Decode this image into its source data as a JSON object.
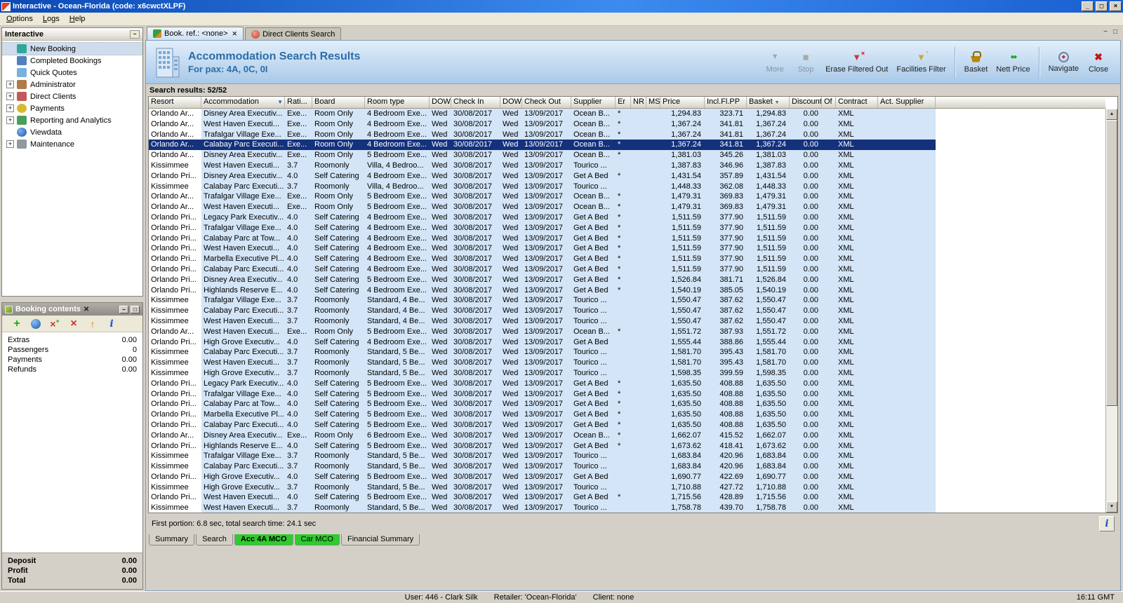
{
  "window": {
    "title": "Interactive - Ocean-Florida (code: x6cwctXLPF)",
    "menu": [
      "Options",
      "Logs",
      "Help"
    ]
  },
  "colors": {
    "selection": "#14317c",
    "row_highlight": "#d3e5f7",
    "active_tab_green": "#2ecc2e",
    "banner_title": "#2d6da8"
  },
  "sidebar": {
    "title": "Interactive",
    "items": [
      {
        "label": "New Booking",
        "icon": "new-booking-icon",
        "expandable": false,
        "selected": true
      },
      {
        "label": "Completed Bookings",
        "icon": "completed-bookings-icon",
        "expandable": false
      },
      {
        "label": "Quick Quotes",
        "icon": "quick-quotes-icon",
        "expandable": false
      },
      {
        "label": "Administrator",
        "icon": "administrator-icon",
        "expandable": true
      },
      {
        "label": "Direct Clients",
        "icon": "direct-clients-icon",
        "expandable": true
      },
      {
        "label": "Payments",
        "icon": "payments-icon",
        "expandable": true
      },
      {
        "label": "Reporting and Analytics",
        "icon": "reporting-icon",
        "expandable": true
      },
      {
        "label": "Viewdata",
        "icon": "viewdata-icon",
        "expandable": false
      },
      {
        "label": "Maintenance",
        "icon": "maintenance-icon",
        "expandable": true
      }
    ]
  },
  "booking_contents": {
    "title": "Booking contents",
    "toolbar": [
      {
        "icon": "add-item-icon"
      },
      {
        "icon": "web-icon"
      },
      {
        "icon": "replace-item-icon"
      },
      {
        "icon": "delete-item-icon"
      },
      {
        "icon": "move-up-icon"
      },
      {
        "icon": "info-icon"
      }
    ],
    "rows": [
      {
        "label": "Extras",
        "value": "0.00"
      },
      {
        "label": "Passengers",
        "value": "0"
      },
      {
        "label": "Payments",
        "value": "0.00"
      },
      {
        "label": "Refunds",
        "value": "0.00"
      }
    ],
    "totals": [
      {
        "label": "Deposit",
        "value": "0.00"
      },
      {
        "label": "Profit",
        "value": "0.00"
      },
      {
        "label": "Total",
        "value": "0.00"
      }
    ]
  },
  "main": {
    "tabs": [
      {
        "label": "Book. ref.: <none>",
        "icon": "palm-tab-icon",
        "active": true,
        "closable": true
      },
      {
        "label": "Direct Clients Search",
        "icon": "client-search-tab-icon",
        "active": false,
        "closable": false
      }
    ],
    "header": {
      "title": "Accommodation Search Results",
      "subtitle": "For pax: 4A, 0C, 0I"
    },
    "toolbar": [
      {
        "label": "More",
        "icon": "more-icon",
        "disabled": true
      },
      {
        "label": "Stop",
        "icon": "stop-icon",
        "disabled": true
      },
      {
        "label": "Erase Filtered Out",
        "icon": "erase-filter-icon"
      },
      {
        "label": "Facilities Filter",
        "icon": "facilities-filter-icon"
      },
      {
        "label": "Basket",
        "icon": "basket-icon",
        "sep_before": true
      },
      {
        "label": "Nett Price",
        "icon": "nett-price-icon"
      },
      {
        "label": "Navigate",
        "icon": "navigate-icon",
        "sep_before": true
      },
      {
        "label": "Close",
        "icon": "close-icon"
      }
    ],
    "results_label": "Search results: 52/52",
    "table": {
      "columns": [
        "Resort",
        {
          "label": "Accommodation",
          "filter": true
        },
        "Rati...",
        "Board",
        "Room type",
        "DOW",
        "Check In",
        "DOW",
        "Check Out",
        "Supplier",
        "Er",
        "NR",
        "MS",
        "Price",
        "Incl.Fl.PP",
        {
          "label": "Basket",
          "sort": true
        },
        "Discount",
        "Of",
        "Contract",
        "Act. Supplier"
      ],
      "shared": {
        "dow_in": "Wed",
        "check_in": "30/08/2017",
        "dow_out": "Wed",
        "check_out": "13/09/2017",
        "discount": "0.00",
        "contract": "XML"
      },
      "selected_index": 3,
      "rows": [
        [
          "Orlando Ar...",
          "Disney Area Executiv...",
          "Exe...",
          "Room Only",
          "4 Bedroom Exe...",
          "Ocean B...",
          "*",
          "1,294.83",
          "323.71",
          "1,294.83"
        ],
        [
          "Orlando Ar...",
          "West Haven Executi...",
          "Exe...",
          "Room Only",
          "4 Bedroom Exe...",
          "Ocean B...",
          "*",
          "1,367.24",
          "341.81",
          "1,367.24"
        ],
        [
          "Orlando Ar...",
          "Trafalgar Village Exe...",
          "Exe...",
          "Room Only",
          "4 Bedroom Exe...",
          "Ocean B...",
          "*",
          "1,367.24",
          "341.81",
          "1,367.24"
        ],
        [
          "Orlando Ar...",
          "Calabay Parc Executi...",
          "Exe...",
          "Room Only",
          "4 Bedroom Exe...",
          "Ocean B...",
          "*",
          "1,367.24",
          "341.81",
          "1,367.24"
        ],
        [
          "Orlando Ar...",
          "Disney Area Executiv...",
          "Exe...",
          "Room Only",
          "5 Bedroom Exe...",
          "Ocean B...",
          "*",
          "1,381.03",
          "345.26",
          "1,381.03"
        ],
        [
          "Kissimmee",
          "West Haven Executi...",
          "3.7",
          "Roomonly",
          "Villa, 4 Bedroo...",
          "Tourico ...",
          "",
          "1,387.83",
          "346.96",
          "1,387.83"
        ],
        [
          "Orlando Pri...",
          "Disney Area Executiv...",
          "4.0",
          "Self Catering",
          "4 Bedroom Exe...",
          "Get A Bed",
          "*",
          "1,431.54",
          "357.89",
          "1,431.54"
        ],
        [
          "Kissimmee",
          "Calabay Parc Executi...",
          "3.7",
          "Roomonly",
          "Villa, 4 Bedroo...",
          "Tourico ...",
          "",
          "1,448.33",
          "362.08",
          "1,448.33"
        ],
        [
          "Orlando Ar...",
          "Trafalgar Village Exe...",
          "Exe...",
          "Room Only",
          "5 Bedroom Exe...",
          "Ocean B...",
          "*",
          "1,479.31",
          "369.83",
          "1,479.31"
        ],
        [
          "Orlando Ar...",
          "West Haven Executi...",
          "Exe...",
          "Room Only",
          "5 Bedroom Exe...",
          "Ocean B...",
          "*",
          "1,479.31",
          "369.83",
          "1,479.31"
        ],
        [
          "Orlando Pri...",
          "Legacy Park Executiv...",
          "4.0",
          "Self Catering",
          "4 Bedroom Exe...",
          "Get A Bed",
          "*",
          "1,511.59",
          "377.90",
          "1,511.59"
        ],
        [
          "Orlando Pri...",
          "Trafalgar Village Exe...",
          "4.0",
          "Self Catering",
          "4 Bedroom Exe...",
          "Get A Bed",
          "*",
          "1,511.59",
          "377.90",
          "1,511.59"
        ],
        [
          "Orlando Pri...",
          "Calabay Parc at Tow...",
          "4.0",
          "Self Catering",
          "4 Bedroom Exe...",
          "Get A Bed",
          "*",
          "1,511.59",
          "377.90",
          "1,511.59"
        ],
        [
          "Orlando Pri...",
          "West Haven Executi...",
          "4.0",
          "Self Catering",
          "4 Bedroom Exe...",
          "Get A Bed",
          "*",
          "1,511.59",
          "377.90",
          "1,511.59"
        ],
        [
          "Orlando Pri...",
          "Marbella Executive Pl...",
          "4.0",
          "Self Catering",
          "4 Bedroom Exe...",
          "Get A Bed",
          "*",
          "1,511.59",
          "377.90",
          "1,511.59"
        ],
        [
          "Orlando Pri...",
          "Calabay Parc Executi...",
          "4.0",
          "Self Catering",
          "4 Bedroom Exe...",
          "Get A Bed",
          "*",
          "1,511.59",
          "377.90",
          "1,511.59"
        ],
        [
          "Orlando Pri...",
          "Disney Area Executiv...",
          "4.0",
          "Self Catering",
          "5 Bedroom Exe...",
          "Get A Bed",
          "*",
          "1,526.84",
          "381.71",
          "1,526.84"
        ],
        [
          "Orlando Pri...",
          "Highlands Reserve E...",
          "4.0",
          "Self Catering",
          "4 Bedroom Exe...",
          "Get A Bed",
          "*",
          "1,540.19",
          "385.05",
          "1,540.19"
        ],
        [
          "Kissimmee",
          "Trafalgar Village Exe...",
          "3.7",
          "Roomonly",
          "Standard, 4 Be...",
          "Tourico ...",
          "",
          "1,550.47",
          "387.62",
          "1,550.47"
        ],
        [
          "Kissimmee",
          "Calabay Parc Executi...",
          "3.7",
          "Roomonly",
          "Standard, 4 Be...",
          "Tourico ...",
          "",
          "1,550.47",
          "387.62",
          "1,550.47"
        ],
        [
          "Kissimmee",
          "West Haven Executi...",
          "3.7",
          "Roomonly",
          "Standard, 4 Be...",
          "Tourico ...",
          "",
          "1,550.47",
          "387.62",
          "1,550.47"
        ],
        [
          "Orlando Ar...",
          "West Haven Executi...",
          "Exe...",
          "Room Only",
          "5 Bedroom Exe...",
          "Ocean B...",
          "*",
          "1,551.72",
          "387.93",
          "1,551.72"
        ],
        [
          "Orlando Pri...",
          "High Grove Executiv...",
          "4.0",
          "Self Catering",
          "4 Bedroom Exe...",
          "Get A Bed",
          "",
          "1,555.44",
          "388.86",
          "1,555.44"
        ],
        [
          "Kissimmee",
          "Calabay Parc Executi...",
          "3.7",
          "Roomonly",
          "Standard, 5 Be...",
          "Tourico ...",
          "",
          "1,581.70",
          "395.43",
          "1,581.70"
        ],
        [
          "Kissimmee",
          "West Haven Executi...",
          "3.7",
          "Roomonly",
          "Standard, 5 Be...",
          "Tourico ...",
          "",
          "1,581.70",
          "395.43",
          "1,581.70"
        ],
        [
          "Kissimmee",
          "High Grove Executiv...",
          "3.7",
          "Roomonly",
          "Standard, 5 Be...",
          "Tourico ...",
          "",
          "1,598.35",
          "399.59",
          "1,598.35"
        ],
        [
          "Orlando Pri...",
          "Legacy Park Executiv...",
          "4.0",
          "Self Catering",
          "5 Bedroom Exe...",
          "Get A Bed",
          "*",
          "1,635.50",
          "408.88",
          "1,635.50"
        ],
        [
          "Orlando Pri...",
          "Trafalgar Village Exe...",
          "4.0",
          "Self Catering",
          "5 Bedroom Exe...",
          "Get A Bed",
          "*",
          "1,635.50",
          "408.88",
          "1,635.50"
        ],
        [
          "Orlando Pri...",
          "Calabay Parc at Tow...",
          "4.0",
          "Self Catering",
          "5 Bedroom Exe...",
          "Get A Bed",
          "*",
          "1,635.50",
          "408.88",
          "1,635.50"
        ],
        [
          "Orlando Pri...",
          "Marbella Executive Pl...",
          "4.0",
          "Self Catering",
          "5 Bedroom Exe...",
          "Get A Bed",
          "*",
          "1,635.50",
          "408.88",
          "1,635.50"
        ],
        [
          "Orlando Pri...",
          "Calabay Parc Executi...",
          "4.0",
          "Self Catering",
          "5 Bedroom Exe...",
          "Get A Bed",
          "*",
          "1,635.50",
          "408.88",
          "1,635.50"
        ],
        [
          "Orlando Ar...",
          "Disney Area Executiv...",
          "Exe...",
          "Room Only",
          "6 Bedroom Exe...",
          "Ocean B...",
          "*",
          "1,662.07",
          "415.52",
          "1,662.07"
        ],
        [
          "Orlando Pri...",
          "Highlands Reserve E...",
          "4.0",
          "Self Catering",
          "5 Bedroom Exe...",
          "Get A Bed",
          "*",
          "1,673.62",
          "418.41",
          "1,673.62"
        ],
        [
          "Kissimmee",
          "Trafalgar Village Exe...",
          "3.7",
          "Roomonly",
          "Standard, 5 Be...",
          "Tourico ...",
          "",
          "1,683.84",
          "420.96",
          "1,683.84"
        ],
        [
          "Kissimmee",
          "Calabay Parc Executi...",
          "3.7",
          "Roomonly",
          "Standard, 5 Be...",
          "Tourico ...",
          "",
          "1,683.84",
          "420.96",
          "1,683.84"
        ],
        [
          "Orlando Pri...",
          "High Grove Executiv...",
          "4.0",
          "Self Catering",
          "5 Bedroom Exe...",
          "Get A Bed",
          "",
          "1,690.77",
          "422.69",
          "1,690.77"
        ],
        [
          "Kissimmee",
          "High Grove Executiv...",
          "3.7",
          "Roomonly",
          "Standard, 5 Be...",
          "Tourico ...",
          "",
          "1,710.88",
          "427.72",
          "1,710.88"
        ],
        [
          "Orlando Pri...",
          "West Haven Executi...",
          "4.0",
          "Self Catering",
          "5 Bedroom Exe...",
          "Get A Bed",
          "*",
          "1,715.56",
          "428.89",
          "1,715.56"
        ],
        [
          "Kissimmee",
          "West Haven Executi...",
          "3.7",
          "Roomonly",
          "Standard, 5 Be...",
          "Tourico ...",
          "",
          "1,758.78",
          "439.70",
          "1,758.78"
        ]
      ]
    },
    "status_text": "First portion: 6.8 sec, total search time: 24.1 sec",
    "bottom_tabs": [
      {
        "label": "Summary",
        "style": "gray"
      },
      {
        "label": "Search",
        "style": "gray"
      },
      {
        "label": "Acc 4A MCO",
        "style": "green",
        "active": true
      },
      {
        "label": "Car MCO",
        "style": "green"
      },
      {
        "label": "Financial Summary",
        "style": "gray"
      }
    ]
  },
  "statusbar": {
    "user": "User: 446 - Clark Silk",
    "retailer": "Retailer: 'Ocean-Florida'",
    "client": "Client: none",
    "time": "16:11 GMT"
  }
}
